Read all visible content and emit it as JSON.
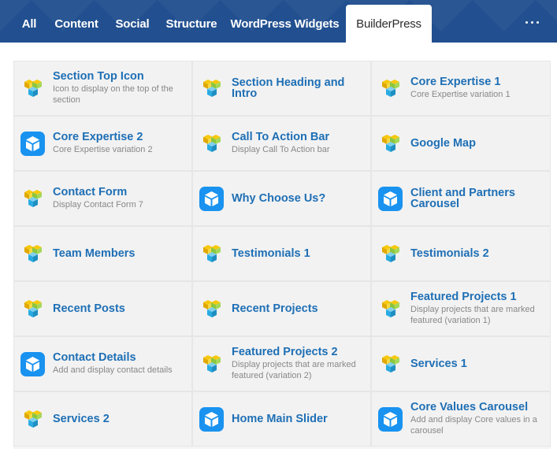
{
  "tabs": [
    {
      "label": "All",
      "active": false
    },
    {
      "label": "Content",
      "active": false
    },
    {
      "label": "Social",
      "active": false
    },
    {
      "label": "Structure",
      "active": false
    },
    {
      "label": "WordPress Widgets",
      "active": false
    },
    {
      "label": "BuilderPress",
      "active": true
    }
  ],
  "more_icon": "ellipsis-icon",
  "colors": {
    "header_bg": "#214f8f",
    "title_blue": "#1e6fb5",
    "badge_blue": "#1992f0",
    "cube_yellow": "#f7c80e",
    "cube_green": "#8cc63e",
    "cube_teal": "#29abe2"
  },
  "elements": [
    {
      "title": "Section Top Icon",
      "desc": "Icon to display on the top of the section",
      "icon": "cube-logo-icon"
    },
    {
      "title": "Section Heading and Intro",
      "desc": "",
      "icon": "cube-logo-icon"
    },
    {
      "title": "Core Expertise 1",
      "desc": "Core Expertise variation 1",
      "icon": "cube-logo-icon"
    },
    {
      "title": "Core Expertise 2",
      "desc": "Core Expertise variation 2",
      "icon": "box-badge-icon"
    },
    {
      "title": "Call To Action Bar",
      "desc": "Display Call To Action bar",
      "icon": "cube-logo-icon"
    },
    {
      "title": "Google Map",
      "desc": "",
      "icon": "cube-logo-icon"
    },
    {
      "title": "Contact Form",
      "desc": "Display Contact Form 7",
      "icon": "cube-logo-icon"
    },
    {
      "title": "Why Choose Us?",
      "desc": "",
      "icon": "box-badge-icon"
    },
    {
      "title": "Client and Partners Carousel",
      "desc": "",
      "icon": "box-badge-icon"
    },
    {
      "title": "Team Members",
      "desc": "",
      "icon": "cube-logo-icon"
    },
    {
      "title": "Testimonials 1",
      "desc": "",
      "icon": "cube-logo-icon"
    },
    {
      "title": "Testimonials 2",
      "desc": "",
      "icon": "cube-logo-icon"
    },
    {
      "title": "Recent Posts",
      "desc": "",
      "icon": "cube-logo-icon"
    },
    {
      "title": "Recent Projects",
      "desc": "",
      "icon": "cube-logo-icon"
    },
    {
      "title": "Featured Projects 1",
      "desc": "Display projects that are marked featured (variation 1)",
      "icon": "cube-logo-icon"
    },
    {
      "title": "Contact Details",
      "desc": "Add and display contact details",
      "icon": "box-badge-icon"
    },
    {
      "title": "Featured Projects 2",
      "desc": "Display projects that are marked featured (variation 2)",
      "icon": "cube-logo-icon"
    },
    {
      "title": "Services 1",
      "desc": "",
      "icon": "cube-logo-icon"
    },
    {
      "title": "Services 2",
      "desc": "",
      "icon": "cube-logo-icon"
    },
    {
      "title": "Home Main Slider",
      "desc": "",
      "icon": "box-badge-icon"
    },
    {
      "title": "Core Values Carousel",
      "desc": "Add and display Core values in a carousel",
      "icon": "box-badge-icon"
    }
  ]
}
